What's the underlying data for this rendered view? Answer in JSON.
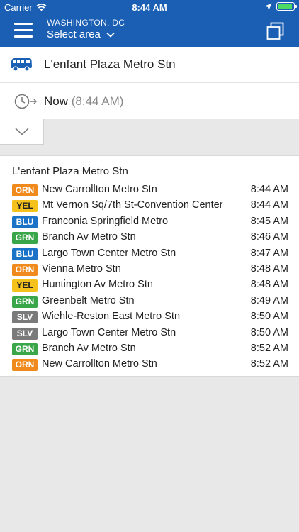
{
  "status_bar": {
    "carrier": "Carrier",
    "time": "8:44 AM"
  },
  "header": {
    "city": "WASHINGTON, DC",
    "select_label": "Select area"
  },
  "trip": {
    "station": "L'enfant Plaza Metro Stn",
    "time_label": "Now",
    "time_value": "(8:44 AM)"
  },
  "departures": {
    "title": "L'enfant Plaza Metro Stn",
    "rows": [
      {
        "line": "ORN",
        "destination": "New Carrollton Metro Stn",
        "time": "8:44 AM"
      },
      {
        "line": "YEL",
        "destination": "Mt Vernon Sq/7th St-Convention Center",
        "time": "8:44 AM"
      },
      {
        "line": "BLU",
        "destination": "Franconia Springfield Metro",
        "time": "8:45 AM"
      },
      {
        "line": "GRN",
        "destination": "Branch Av Metro Stn",
        "time": "8:46 AM"
      },
      {
        "line": "BLU",
        "destination": "Largo Town Center Metro Stn",
        "time": "8:47 AM"
      },
      {
        "line": "ORN",
        "destination": "Vienna Metro Stn",
        "time": "8:48 AM"
      },
      {
        "line": "YEL",
        "destination": "Huntington Av Metro Stn",
        "time": "8:48 AM"
      },
      {
        "line": "GRN",
        "destination": "Greenbelt Metro Stn",
        "time": "8:49 AM"
      },
      {
        "line": "SLV",
        "destination": "Wiehle-Reston East Metro Stn",
        "time": "8:50 AM"
      },
      {
        "line": "SLV",
        "destination": "Largo Town Center Metro Stn",
        "time": "8:50 AM"
      },
      {
        "line": "GRN",
        "destination": "Branch Av Metro Stn",
        "time": "8:52 AM"
      },
      {
        "line": "ORN",
        "destination": "New Carrollton Metro Stn",
        "time": "8:52 AM"
      }
    ]
  },
  "colors": {
    "brand": "#1a5fb4",
    "ORN": "#f08a1c",
    "YEL": "#f5c21b",
    "BLU": "#1a73c7",
    "GRN": "#3aa64a",
    "SLV": "#7a7a7a"
  },
  "icons": {
    "menu": "hamburger-menu-icon",
    "dropdown": "chevron-down-icon",
    "copy": "copy-icon",
    "station": "bus-icon",
    "time": "clock-arrow-icon",
    "expand": "chevron-down-icon"
  }
}
